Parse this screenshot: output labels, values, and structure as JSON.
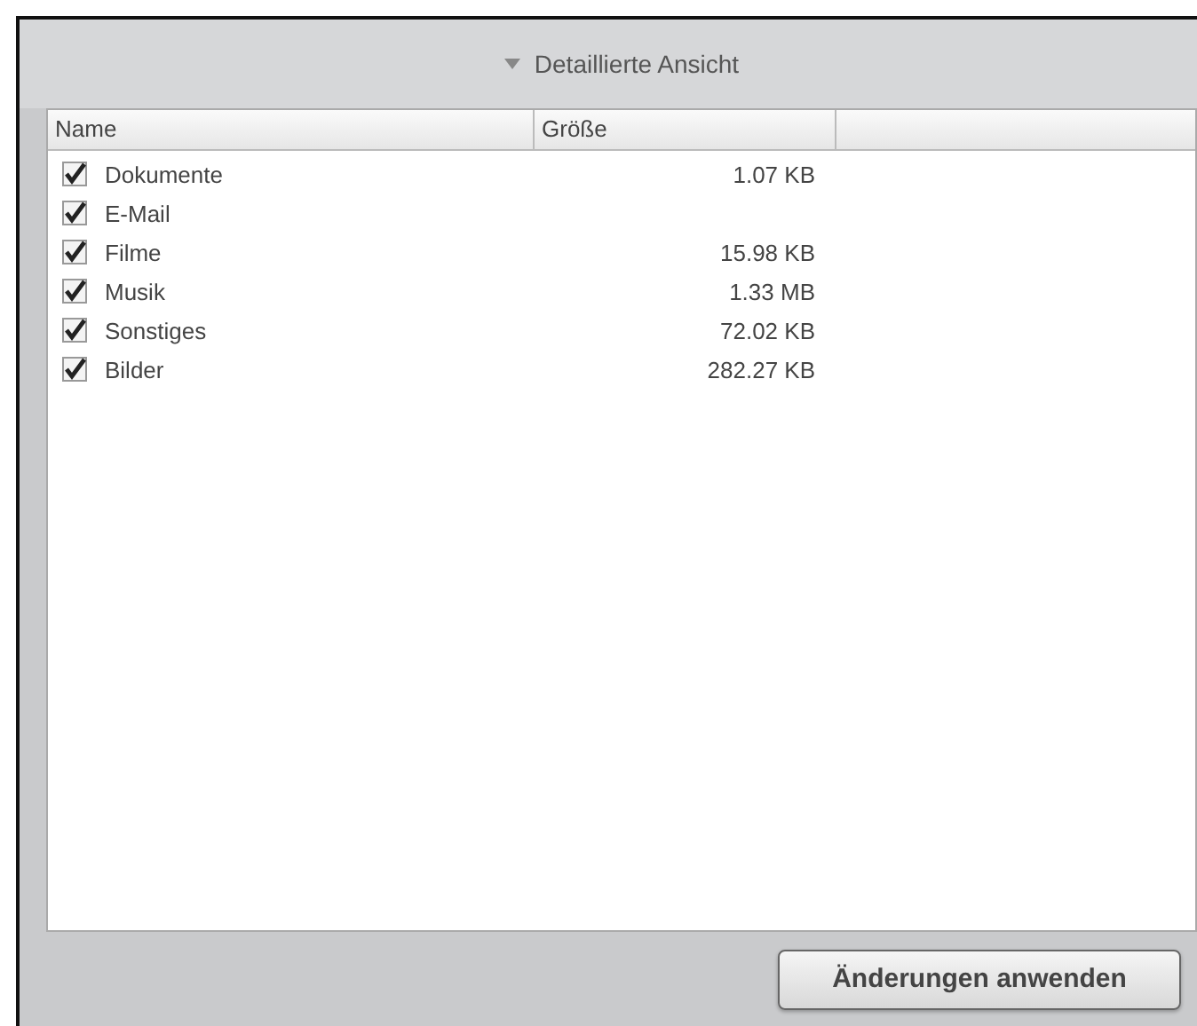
{
  "header": {
    "title": "Detaillierte Ansicht",
    "expanded": true
  },
  "table": {
    "columns": [
      "Name",
      "Größe"
    ],
    "rows": [
      {
        "name": "Dokumente",
        "size": "1.07 KB",
        "checked": true
      },
      {
        "name": "E-Mail",
        "size": "",
        "checked": true
      },
      {
        "name": "Filme",
        "size": "15.98 KB",
        "checked": true
      },
      {
        "name": "Musik",
        "size": "1.33 MB",
        "checked": true
      },
      {
        "name": "Sonstiges",
        "size": "72.02 KB",
        "checked": true
      },
      {
        "name": "Bilder",
        "size": "282.27 KB",
        "checked": true
      }
    ]
  },
  "apply_button": "Änderungen anwenden"
}
